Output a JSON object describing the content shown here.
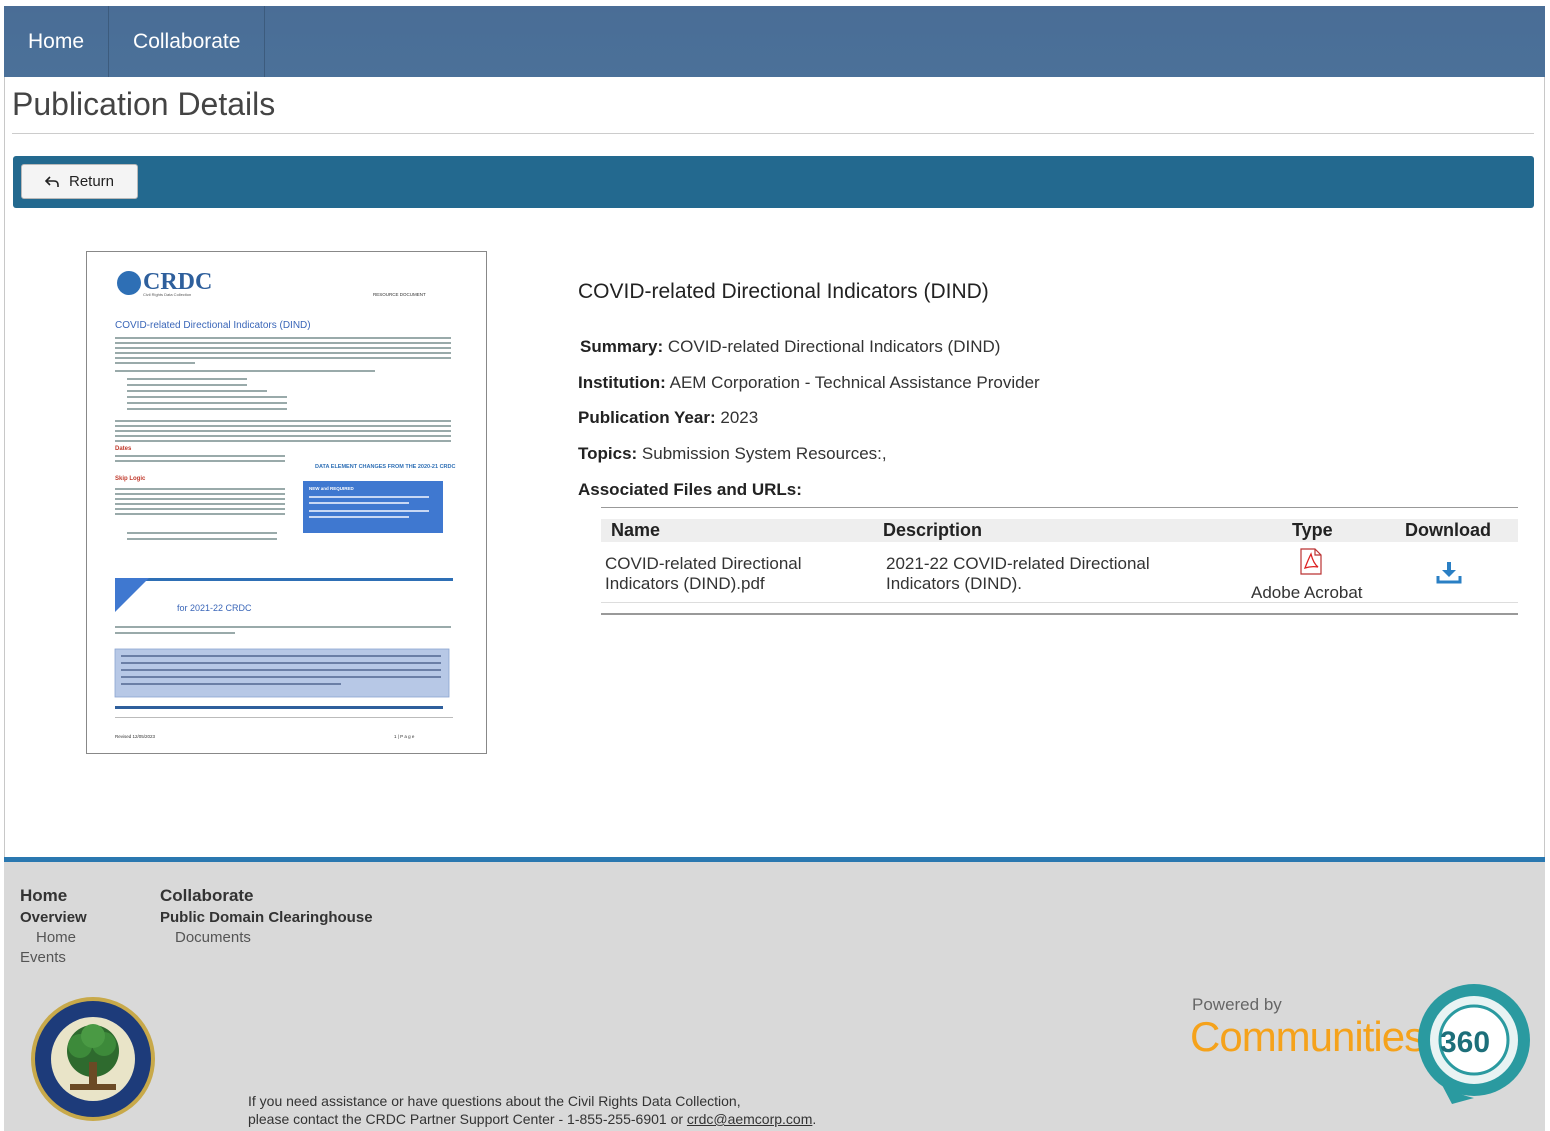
{
  "nav": {
    "items": [
      "Home",
      "Collaborate"
    ]
  },
  "page": {
    "title": "Publication Details",
    "return_label": "Return"
  },
  "publication": {
    "title": "COVID-related Directional Indicators (DIND)",
    "summary_label": "Summary:",
    "summary": "COVID-related Directional Indicators (DIND)",
    "institution_label": "Institution:",
    "institution": "AEM Corporation - Technical Assistance Provider",
    "year_label": "Publication Year:",
    "year": "2023",
    "topics_label": "Topics:",
    "topics": "Submission System Resources:,",
    "files_label": "Associated Files and URLs:"
  },
  "files_table": {
    "headers": [
      "Name",
      "Description",
      "Type",
      "Download"
    ],
    "rows": [
      {
        "name_line1": "COVID-related Directional",
        "name_line2": "Indicators (DIND).pdf",
        "desc_line1": "2021-22 COVID-related Directional",
        "desc_line2": "Indicators (DIND).",
        "type": "Adobe Acrobat",
        "type_icon": "pdf-icon",
        "download_icon": "download-icon"
      }
    ]
  },
  "thumbnail": {
    "logo": "CRDC",
    "logo_sub": "Civil Rights Data Collection",
    "resource": "RESOURCE DOCUMENT",
    "heading": "COVID-related Directional Indicators (DIND)",
    "section_dates": "Dates",
    "section_skip": "Skip Logic",
    "box_title": "DATA ELEMENT CHANGES FROM THE 2020-21 CRDC",
    "box_sub": "NEW and REQUIRED",
    "changes_heading": "for 2021-22 CRDC",
    "footer_left": "Revised 12/05/2023",
    "footer_right": "1 | P a g e"
  },
  "footer": {
    "col1_heading": "Home",
    "col1_sub": "Overview",
    "col1_link1": "Home",
    "col1_link2": "Events",
    "col2_heading": "Collaborate",
    "col2_sub": "Public Domain Clearinghouse",
    "col2_link1": "Documents",
    "assist_line1": "If you need assistance or have questions about the Civil Rights Data Collection,",
    "assist_line2_prefix": "please contact the CRDC Partner Support Center - 1-855-255-6901 or ",
    "assist_email": "crdc@aemcorp.com",
    "assist_suffix": ".",
    "powered_by": "Powered by",
    "brand": "Communities",
    "brand_number": "360"
  },
  "colors": {
    "nav": "#4b7199",
    "returnbar": "#23698f",
    "footer_rule": "#2a78b0",
    "brand_orange": "#f5a21b",
    "brand_teal": "#2a9aa0"
  }
}
